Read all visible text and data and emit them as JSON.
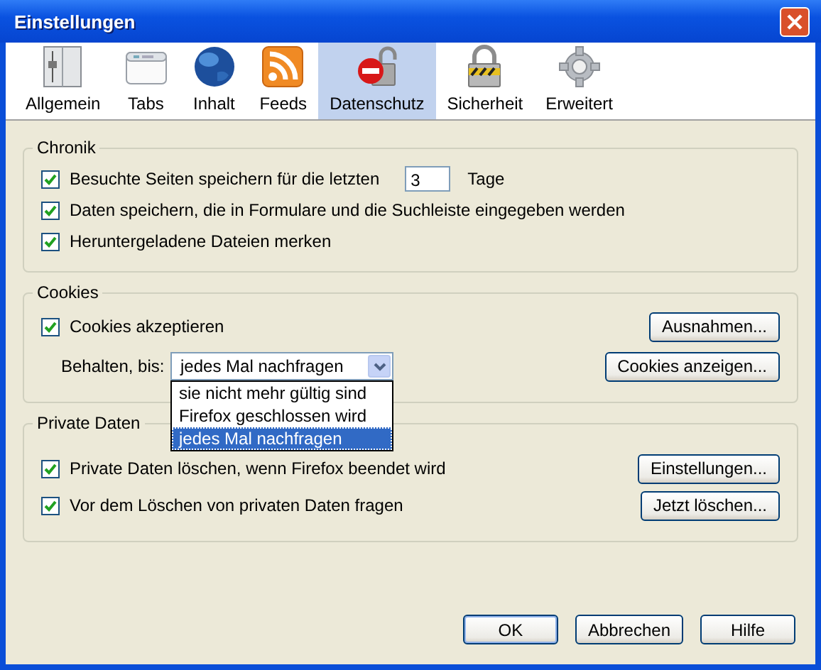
{
  "window": {
    "title": "Einstellungen"
  },
  "toolbar": [
    {
      "label": "Allgemein",
      "selected": false
    },
    {
      "label": "Tabs",
      "selected": false
    },
    {
      "label": "Inhalt",
      "selected": false
    },
    {
      "label": "Feeds",
      "selected": false
    },
    {
      "label": "Datenschutz",
      "selected": true
    },
    {
      "label": "Sicherheit",
      "selected": false
    },
    {
      "label": "Erweitert",
      "selected": false
    }
  ],
  "sections": [
    {
      "title": "Chronik",
      "rows": [
        {
          "kind": "checkbox_field",
          "label": "Besuchte Seiten speichern für die letzten",
          "checked": true,
          "value": "3",
          "unit": "Tage"
        },
        {
          "kind": "checkbox",
          "label": "Daten speichern, die in Formulare und die Suchleiste eingegeben werden",
          "checked": true
        },
        {
          "kind": "checkbox",
          "label": "Heruntergeladene Dateien merken",
          "checked": true
        }
      ]
    },
    {
      "title": "Cookies",
      "rows": [
        {
          "kind": "checkbox",
          "label": "Cookies akzeptieren",
          "checked": true,
          "button": "Ausnahmen..."
        },
        {
          "kind": "dropdown",
          "label": "Behalten, bis:",
          "value": "jedes Mal nachfragen",
          "expanded": true,
          "button": "Cookies anzeigen...",
          "options": [
            {
              "label": "sie nicht mehr gültig sind",
              "selected": false
            },
            {
              "label": "Firefox geschlossen wird",
              "selected": false
            },
            {
              "label": "jedes Mal nachfragen",
              "selected": true
            }
          ]
        }
      ]
    },
    {
      "title": "Private Daten",
      "rows": [
        {
          "kind": "checkbox",
          "label": "Private Daten löschen, wenn Firefox beendet wird",
          "checked": true,
          "button": "Einstellungen..."
        },
        {
          "kind": "checkbox",
          "label": "Vor dem Löschen von privaten Daten fragen",
          "checked": true,
          "button": "Jetzt löschen..."
        }
      ]
    }
  ],
  "buttons": [
    "OK",
    "Abbrechen",
    "Hilfe"
  ]
}
